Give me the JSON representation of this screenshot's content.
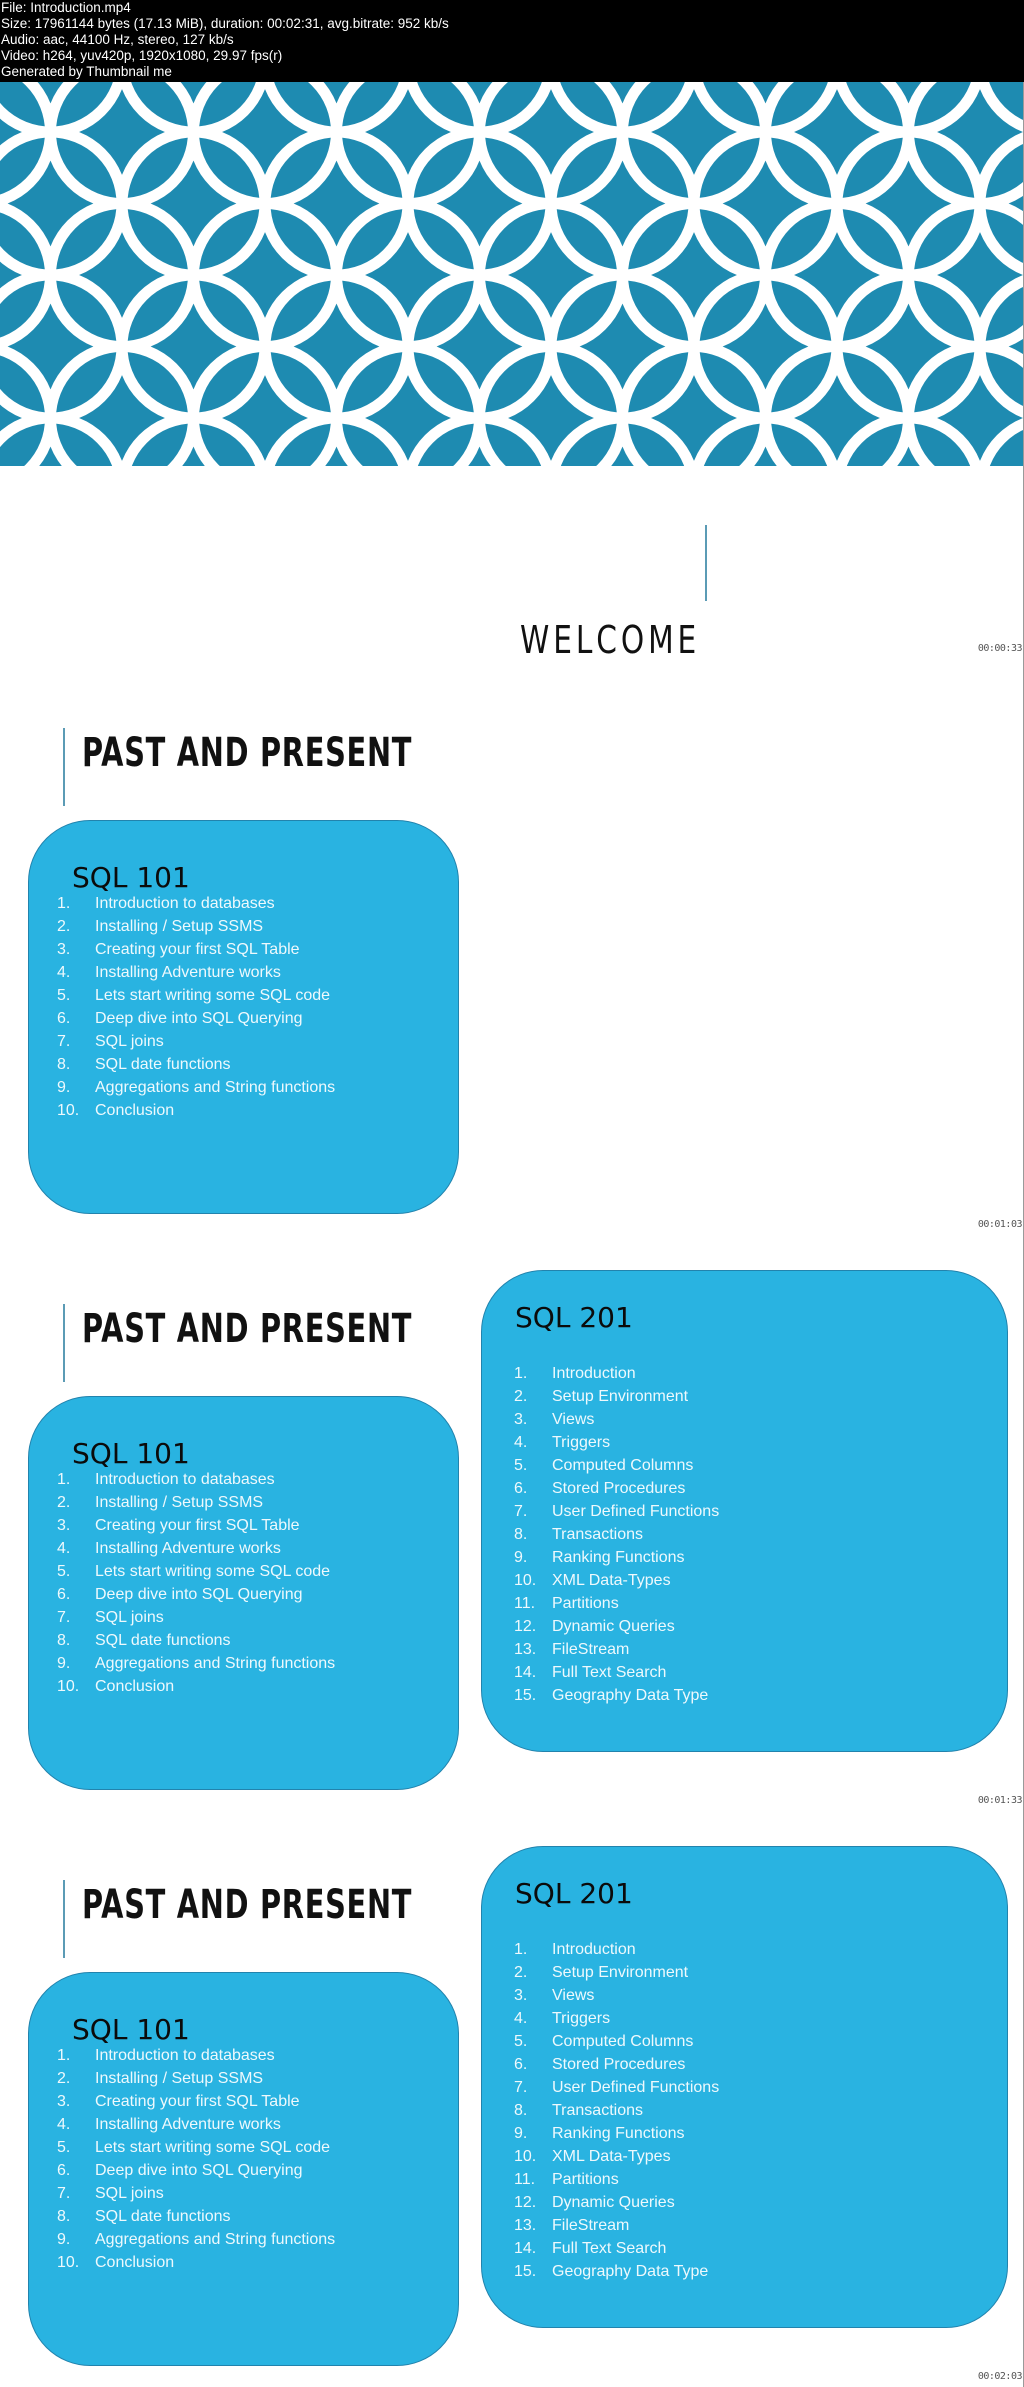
{
  "file_info": [
    "File: Introduction.mp4",
    "Size: 17961144 bytes (17.13 MiB), duration: 00:02:31, avg.bitrate: 952 kb/s",
    "Audio: aac, 44100 Hz, stereo, 127 kb/s",
    "Video: h264, yuv420p, 1920x1080, 29.97 fps(r)",
    "Generated by Thumbnail me"
  ],
  "colors": {
    "pattern_bg": "#1e8bb1",
    "pattern_lines": "#ffffff",
    "box": "#29b3e1",
    "accent_line": "#5b9bb5"
  },
  "frames": [
    {
      "type": "welcome",
      "title": "WELCOME",
      "timestamp": "00:00:33"
    },
    {
      "type": "course",
      "title": "PAST AND PRESENT",
      "timestamp": "00:01:03",
      "show201": false
    },
    {
      "type": "course",
      "title": "PAST AND PRESENT",
      "timestamp": "00:01:33",
      "show201": true
    },
    {
      "type": "course",
      "title": "PAST AND PRESENT",
      "timestamp": "00:02:03",
      "show201": true
    }
  ],
  "sql101": {
    "heading": "SQL 101",
    "items": [
      {
        "n": "1.",
        "t": "Introduction to databases"
      },
      {
        "n": "2.",
        "t": "Installing / Setup SSMS"
      },
      {
        "n": "3.",
        "t": "Creating your first SQL Table"
      },
      {
        "n": "4.",
        "t": "Installing Adventure works"
      },
      {
        "n": "5.",
        "t": "Lets start writing some SQL code"
      },
      {
        "n": "6.",
        "t": "Deep dive into SQL Querying"
      },
      {
        "n": "7.",
        "t": "SQL joins"
      },
      {
        "n": "8.",
        "t": "SQL date functions"
      },
      {
        "n": "9.",
        "t": "Aggregations and String functions"
      },
      {
        "n": "10.",
        "t": "Conclusion"
      }
    ]
  },
  "sql201": {
    "heading": "SQL 201",
    "items": [
      {
        "n": "1.",
        "t": "Introduction"
      },
      {
        "n": "2.",
        "t": "Setup Environment"
      },
      {
        "n": "3.",
        "t": "Views"
      },
      {
        "n": "4.",
        "t": "Triggers"
      },
      {
        "n": "5.",
        "t": "Computed Columns"
      },
      {
        "n": "6.",
        "t": "Stored Procedures"
      },
      {
        "n": "7.",
        "t": "User Defined Functions"
      },
      {
        "n": "8.",
        "t": "Transactions"
      },
      {
        "n": "9.",
        "t": "Ranking Functions"
      },
      {
        "n": "10.",
        "t": "XML Data-Types"
      },
      {
        "n": "11.",
        "t": "Partitions"
      },
      {
        "n": "12.",
        "t": "Dynamic Queries"
      },
      {
        "n": "13.",
        "t": "FileStream"
      },
      {
        "n": "14.",
        "t": "Full Text Search"
      },
      {
        "n": "15.",
        "t": "Geography Data Type"
      }
    ]
  }
}
